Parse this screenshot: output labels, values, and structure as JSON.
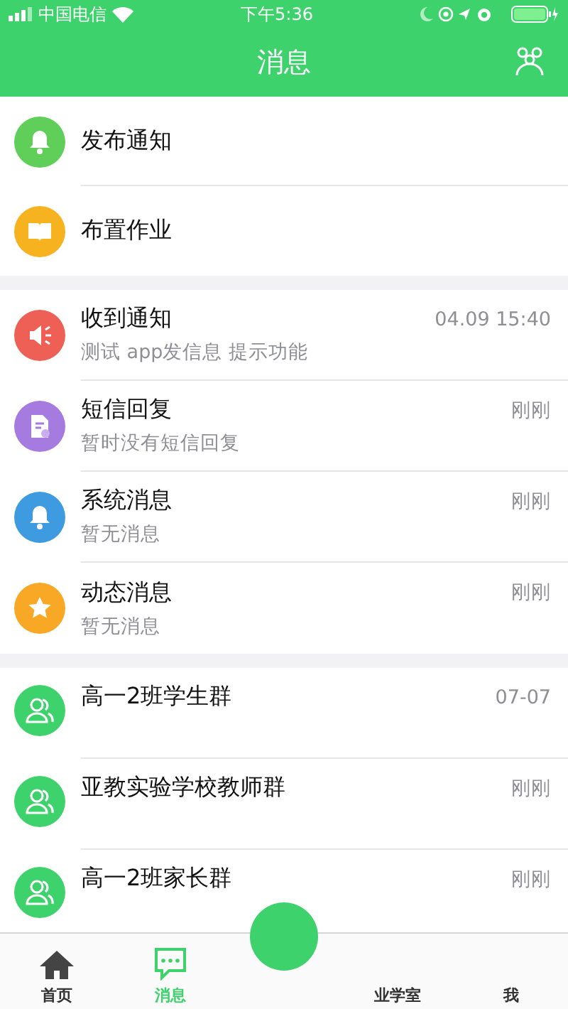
{
  "status_bar": {
    "carrier": "中国电信",
    "time": "下午5:36"
  },
  "header": {
    "title": "消息"
  },
  "quick_actions": [
    {
      "label": "发布通知",
      "kind": "bell",
      "color": "#5fcf5a"
    },
    {
      "label": "布置作业",
      "kind": "book",
      "color": "#f6b21f"
    }
  ],
  "notifications": [
    {
      "title": "收到通知",
      "subtitle": "测试 app发信息 提示功能",
      "time": "04.09 15:40",
      "kind": "megaphone",
      "color": "#ee6055"
    },
    {
      "title": "短信回复",
      "subtitle": "暂时没有短信回复",
      "time": "刚刚",
      "kind": "sms",
      "color": "#a57be0"
    },
    {
      "title": "系统消息",
      "subtitle": "暂无消息",
      "time": "刚刚",
      "kind": "bell",
      "color": "#3e9be0"
    },
    {
      "title": "动态消息",
      "subtitle": "暂无消息",
      "time": "刚刚",
      "kind": "star",
      "color": "#f8a825"
    }
  ],
  "groups": [
    {
      "name": "高一2班学生群",
      "time": "07-07"
    },
    {
      "name": "亚教实验学校教师群",
      "time": "刚刚"
    },
    {
      "name": "高一2班家长群",
      "time": "刚刚"
    }
  ],
  "tab_bar": [
    {
      "label": "首页",
      "kind": "home",
      "selected": false
    },
    {
      "label": "消息",
      "kind": "chat",
      "selected": true
    },
    {
      "kind": "center",
      "selected": false
    },
    {
      "label": "业学室",
      "kind": "plain",
      "selected": false
    },
    {
      "label": "我",
      "kind": "plain",
      "selected": false
    }
  ]
}
